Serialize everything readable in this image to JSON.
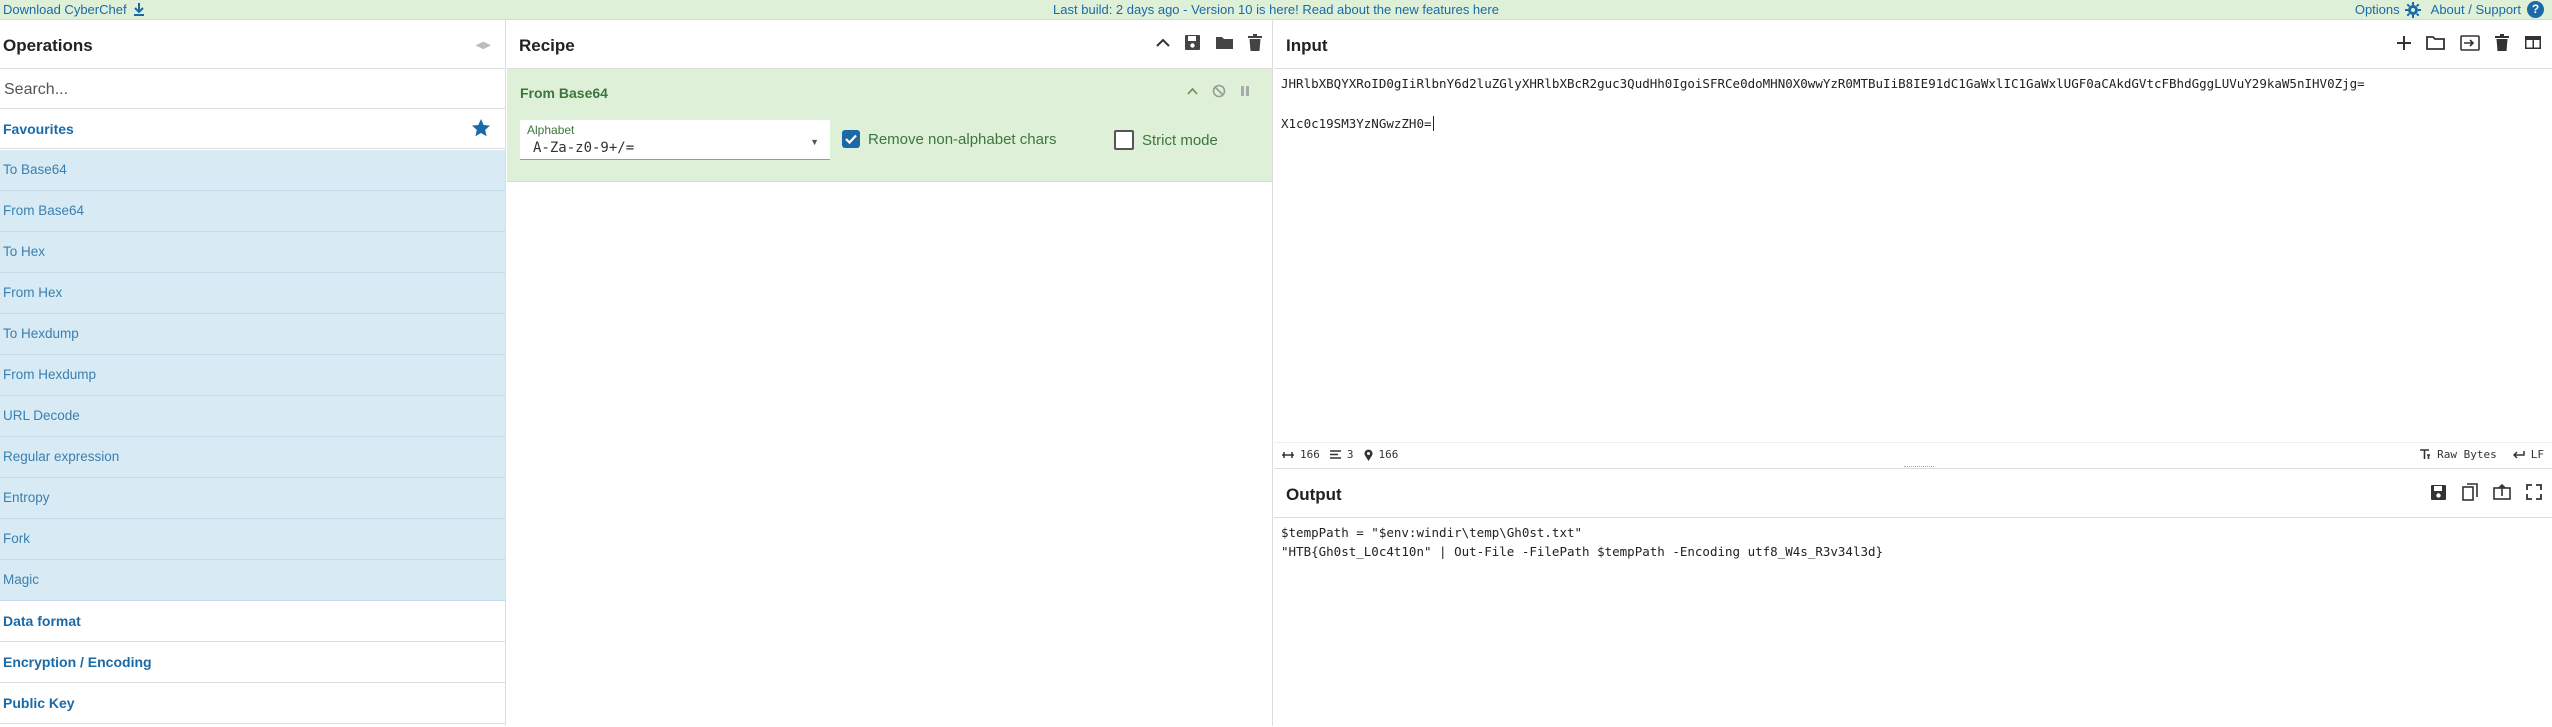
{
  "banner": {
    "download_label": "Download CyberChef",
    "build_message": "Last build: 2 days ago - Version 10 is here! Read about the new features here",
    "options_label": "Options",
    "about_label": "About / Support"
  },
  "operations": {
    "title": "Operations",
    "search_placeholder": "Search...",
    "favourites_label": "Favourites",
    "favourites": [
      "To Base64",
      "From Base64",
      "To Hex",
      "From Hex",
      "To Hexdump",
      "From Hexdump",
      "URL Decode",
      "Regular expression",
      "Entropy",
      "Fork",
      "Magic"
    ],
    "categories": [
      "Data format",
      "Encryption / Encoding",
      "Public Key"
    ]
  },
  "recipe": {
    "title": "Recipe",
    "operation": {
      "name": "From Base64",
      "alphabet_label": "Alphabet",
      "alphabet_value": "A-Za-z0-9+/=",
      "remove_nonalpha_label": "Remove non-alphabet chars",
      "remove_nonalpha_checked": true,
      "strict_mode_label": "Strict mode",
      "strict_mode_checked": false
    }
  },
  "input": {
    "title": "Input",
    "line1": "JHRlbXBQYXRoID0gIiRlbnY6d2luZGlyXHRlbXBcR2guc3QudHh0IgoiSFRCe0doMHN0X0wwYzR0MTBuIiB8IE91dC1GaWxlIC1GaWxlUGF0aCAkdGVtcFBhdGggLUVuY29kaW5nIHV0Zjg=",
    "line2": "",
    "line3": "X1c0c19SM3YzNGwzZH0=",
    "status": {
      "length": "166",
      "lines": "3",
      "position": "166",
      "encoding": "Raw Bytes",
      "eol": "LF"
    }
  },
  "output": {
    "title": "Output",
    "line1": "$tempPath = \"$env:windir\\temp\\Gh0st.txt\"",
    "line2": "\"HTB{Gh0st_L0c4t10n\" | Out-File -FilePath $tempPath -Encoding utf8_W4s_R3v34l3d}"
  },
  "colors": {
    "accent": "#1a6aa8",
    "recipe_bg": "#dff0d8",
    "favourite_bg": "#d8ebf5",
    "success_text": "#3c763d"
  }
}
